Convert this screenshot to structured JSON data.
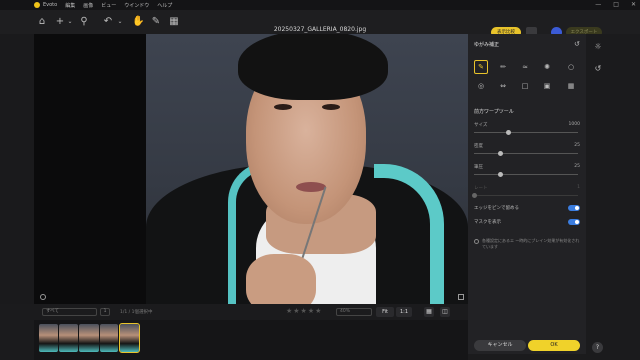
{
  "menubar": {
    "app": "Evoto",
    "items": [
      "編集",
      "画像",
      "ビュー",
      "ウインドウ",
      "ヘルプ"
    ]
  },
  "toolbar": {
    "filename": "20250327_GALLERIA_0820.jpg",
    "compare_label": "表示比較",
    "apply_label": "エクスポート"
  },
  "panel": {
    "title": "ゆがみ補正",
    "section": "前方ワープツール",
    "sliders": [
      {
        "label": "サイズ",
        "value": "1000",
        "fraction": 0.33
      },
      {
        "label": "密度",
        "value": "25",
        "fraction": 0.25
      },
      {
        "label": "筆圧",
        "value": "25",
        "fraction": 0.25
      },
      {
        "label": "レート",
        "value": "1",
        "fraction": 0.0,
        "disabled": true
      }
    ],
    "toggles": [
      {
        "label": "エッジをピンで留める",
        "on": true
      },
      {
        "label": "マスクを表示",
        "on": true
      }
    ],
    "note": "各種設定にあるエ ー時的にプレイン効果が有効化されています",
    "cancel_label": "キャンセル",
    "ok_label": "OK"
  },
  "bottom": {
    "filter": "すべて",
    "count_badge": "1",
    "count_text": "1/1 / 1個選択中",
    "zoom": "40%",
    "fit_label": "Fit",
    "one_label": "1:1"
  },
  "help": "?"
}
